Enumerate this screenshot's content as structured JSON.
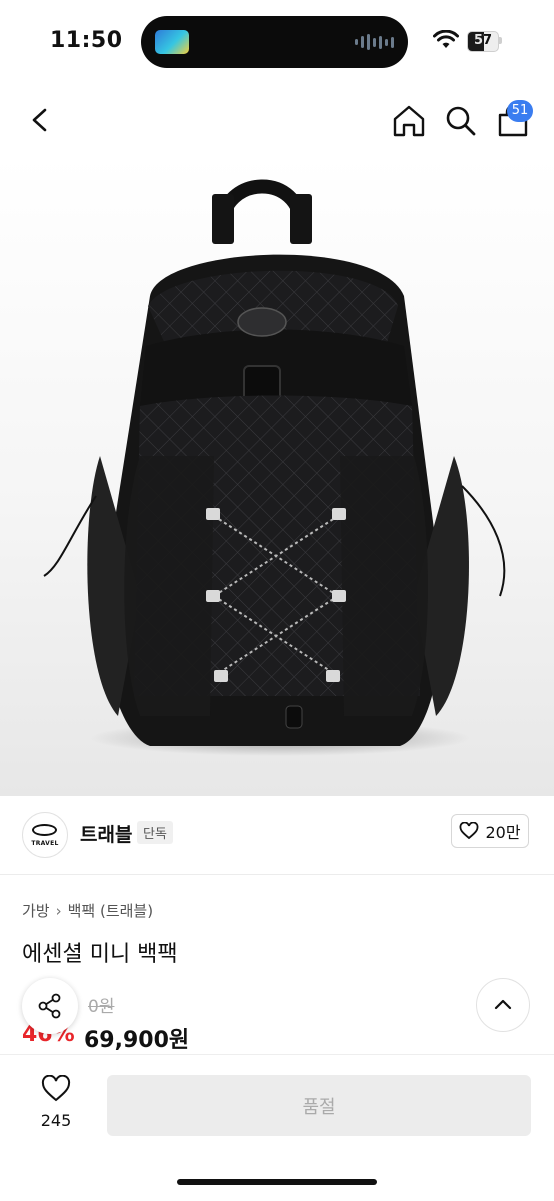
{
  "status_bar": {
    "time": "11:50",
    "battery": "57"
  },
  "header": {
    "cart_count": "51"
  },
  "brand": {
    "logo_text": "TRAVEL",
    "name": "트래블",
    "tag": "단독",
    "likes": "20만"
  },
  "breadcrumb": {
    "category": "가방",
    "subcategory": "백팩 (트래블)"
  },
  "product": {
    "title": "에센셜 미니 백팩",
    "original_price": "0원",
    "discount": "46%",
    "price": "69,900원"
  },
  "bottom_bar": {
    "wish_count": "245",
    "soldout_label": "품절"
  },
  "colors": {
    "accent_blue": "#3a7df0",
    "discount_red": "#e8262b"
  }
}
